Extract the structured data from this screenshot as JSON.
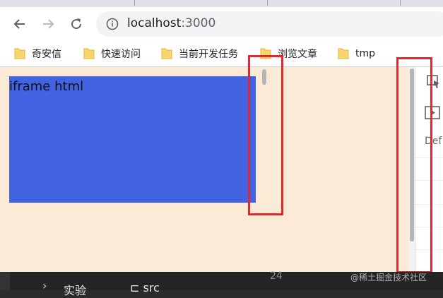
{
  "browser": {
    "url_host": "localhost",
    "url_port": ":3000",
    "nav": {
      "back_icon": "back-arrow-icon",
      "forward_icon": "forward-arrow-icon",
      "reload_icon": "reload-icon",
      "info_icon": "site-info-icon"
    }
  },
  "bookmarks": [
    {
      "label": "奇安信",
      "icon": "folder-icon"
    },
    {
      "label": "快速访问",
      "icon": "folder-icon"
    },
    {
      "label": "当前开发任务",
      "icon": "folder-icon"
    },
    {
      "label": "浏览文章",
      "icon": "folder-icon"
    },
    {
      "label": "tmp",
      "icon": "folder-icon"
    }
  ],
  "page": {
    "iframe_text": "iframe html"
  },
  "devtools": {
    "label_partial": "Def",
    "icons": [
      "inspect-element-icon",
      "play-icon"
    ]
  },
  "editor": {
    "line_number": "24",
    "item_text": "实验",
    "item_text2": "⊏ src",
    "watermark": "@稀土掘金技术社区"
  },
  "colors": {
    "page_bg": "#fbead6",
    "iframe_content": "#4264e2",
    "annotation": "#e0282e"
  }
}
